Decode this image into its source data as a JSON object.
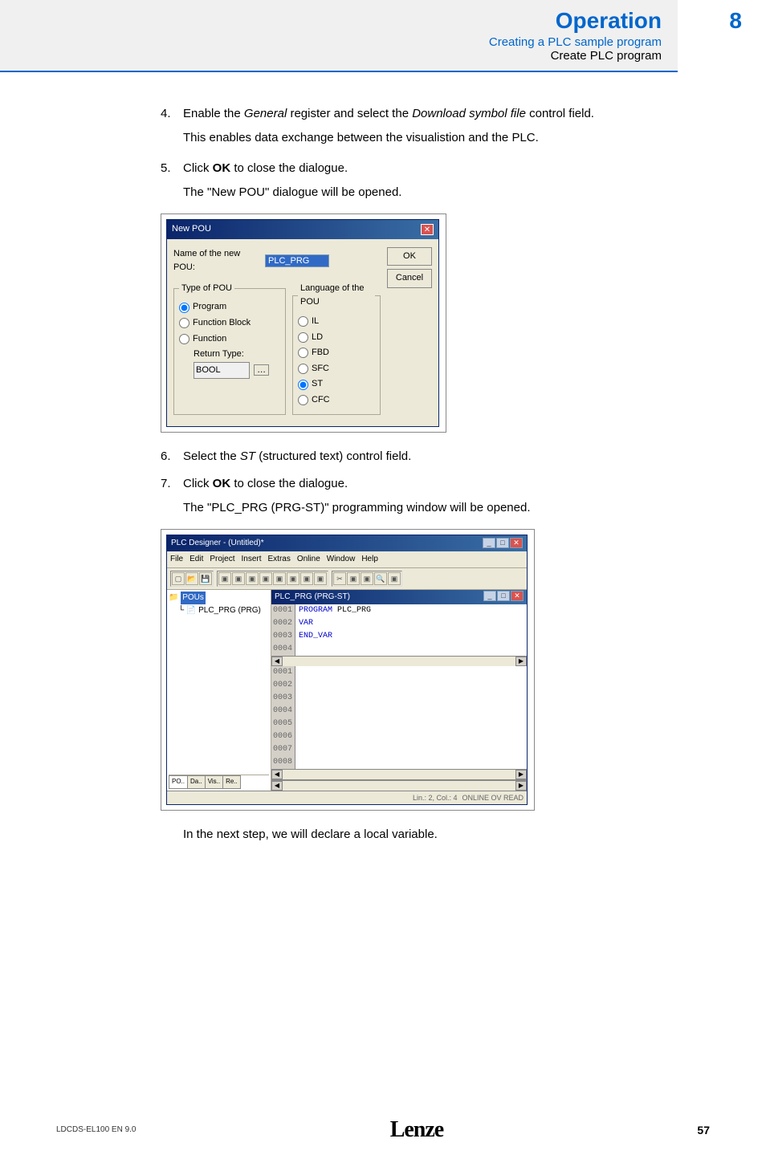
{
  "header": {
    "title": "Operation",
    "sub1": "Creating a PLC sample program",
    "sub2": "Create PLC program",
    "pagenum": "8"
  },
  "steps": {
    "s4": {
      "num": "4.",
      "text_pre": "Enable the ",
      "i1": "General",
      "text_mid": " register and select the ",
      "i2": "Download symbol file",
      "text_post": " control field.",
      "sub": "This enables data exchange between the visualistion and the PLC."
    },
    "s5": {
      "num": "5.",
      "text_pre": "Click ",
      "b1": "OK",
      "text_post": " to close the dialogue.",
      "sub": "The \"New POU\" dialogue will be opened."
    },
    "s6": {
      "num": "6.",
      "text_pre": "Select the ",
      "i1": "ST",
      "text_post": " (structured text) control field."
    },
    "s7": {
      "num": "7.",
      "text_pre": "Click ",
      "b1": "OK",
      "text_post": " to close the dialogue.",
      "sub": "The \"PLC_PRG (PRG-ST)\" programming window will be opened."
    },
    "closing": "In the next step, we will declare a local variable."
  },
  "dialog": {
    "title": "New POU",
    "name_label": "Name of the new POU:",
    "name_value": "PLC_PRG",
    "grp_type": "Type of POU",
    "type_program": "Program",
    "type_fb": "Function Block",
    "type_fn": "Function",
    "return_type": "Return Type:",
    "return_val": "BOOL",
    "grp_lang": "Language of the POU",
    "lang_il": "IL",
    "lang_ld": "LD",
    "lang_fbd": "FBD",
    "lang_sfc": "SFC",
    "lang_st": "ST",
    "lang_cfc": "CFC",
    "btn_ok": "OK",
    "btn_cancel": "Cancel"
  },
  "plc": {
    "title": "PLC Designer - (Untitled)*",
    "menu": [
      "File",
      "Edit",
      "Project",
      "Insert",
      "Extras",
      "Online",
      "Window",
      "Help"
    ],
    "tree_root": "POUs",
    "tree_item": "PLC_PRG (PRG)",
    "tree_tabs": [
      "PO..",
      "Da..",
      "Vis..",
      "Re.."
    ],
    "ed_title": "PLC_PRG (PRG-ST)",
    "code1": {
      "n": "0001",
      "t": "PROGRAM PLC_PRG"
    },
    "code2": {
      "n": "0002",
      "t": "VAR"
    },
    "code3": {
      "n": "0003",
      "t": "END_VAR"
    },
    "empty_lines": [
      "0001",
      "0002",
      "0003",
      "0004",
      "0005",
      "0006",
      "0007",
      "0008"
    ],
    "status_pos": "Lin.: 2, Col.: 4",
    "status_mode": "ONLINE  OV  READ"
  },
  "footer": {
    "left": "LDCDS-EL100  EN  9.0",
    "logo": "Lenze",
    "right": "57"
  }
}
